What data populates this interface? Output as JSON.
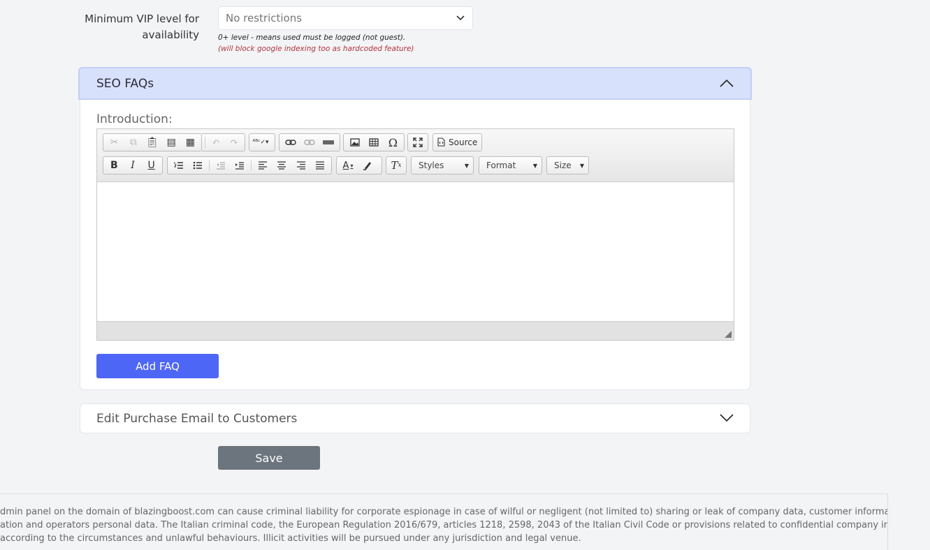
{
  "vip": {
    "label": "Minimum VIP level for availability",
    "selected": "No restrictions",
    "hint": "0+ level - means used must be logged (not guest).",
    "warning": "(will block google indexing too as hardcoded feature)"
  },
  "seo_faqs": {
    "title": "SEO FAQs",
    "intro_label": "Introduction:",
    "add_button": "Add FAQ",
    "toolbar": {
      "source_label": "Source",
      "styles_label": "Styles",
      "format_label": "Format",
      "size_label": "Size",
      "icons": [
        "cut-icon",
        "copy-icon",
        "paste-icon",
        "paste-text-icon",
        "paste-word-icon",
        "undo-icon",
        "redo-icon",
        "spellcheck-icon",
        "link-icon",
        "unlink-icon",
        "anchor-icon",
        "image-icon",
        "table-icon",
        "special-char-icon",
        "maximize-icon",
        "source-icon",
        "bold-icon",
        "italic-icon",
        "underline-icon",
        "numbered-list-icon",
        "bulleted-list-icon",
        "outdent-icon",
        "indent-icon",
        "align-left-icon",
        "align-center-icon",
        "align-right-icon",
        "justify-icon",
        "text-color-icon",
        "background-color-icon",
        "remove-format-icon"
      ]
    }
  },
  "purchase_email": {
    "title": "Edit Purchase Email to Customers"
  },
  "save_label": "Save",
  "footer": {
    "line1": "dmin panel on the domain of blazingboost.com can cause criminal liability for corporate espionage in case of wilful or negligent (not limited to) sharing or leak of company data, customer information, sales,",
    "line2": "ation and operators personal data. The Italian criminal code, the European Regulation 2016/679, articles 1218, 2598, 2043 of the Italian Civil Code or provisions related to confidential company information",
    "line3": "according to the circumstances and unlawful behaviours. Illicit activities will be pursued under any jurisdiction and legal venue."
  },
  "colors": {
    "accent": "#4e66f6",
    "panel_header": "#d8e1fb",
    "save": "#6c757d",
    "warning": "#b0323a"
  }
}
